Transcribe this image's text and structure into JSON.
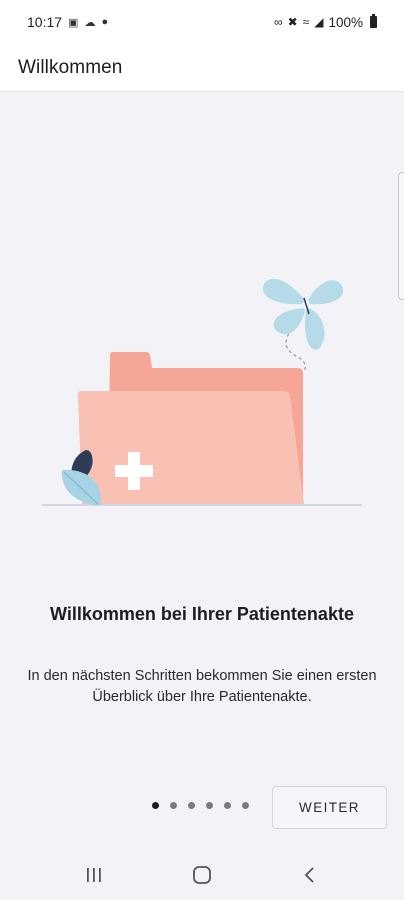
{
  "status_bar": {
    "time": "10:17",
    "battery": "100%",
    "left_icons": [
      "notification-icon",
      "cloud-icon",
      "location-icon"
    ],
    "right_icons": [
      "link-icon",
      "mute-icon",
      "wifi-icon",
      "signal-icon",
      "battery-icon"
    ]
  },
  "app_bar": {
    "title": "Willkommen"
  },
  "onboarding": {
    "headline": "Willkommen bei Ihrer Patientenakte",
    "description": "In den nächsten Schritten bekommen Sie einen ersten Überblick über Ihre Patientenakte.",
    "illustration": "folder-with-medical-cross-illustration",
    "page_count": 6,
    "current_page": 1
  },
  "actions": {
    "next_label": "WEITER"
  },
  "nav_bar": {
    "buttons": [
      "recent-apps-icon",
      "home-icon",
      "back-icon"
    ]
  },
  "colors": {
    "background": "#f3f2f6",
    "folder_back": "#f6a696",
    "folder_front": "#f9c1b3",
    "butterfly": "#b5dbe9",
    "leaf_dark": "#2f3c55",
    "leaf_light": "#a6d3e5"
  }
}
